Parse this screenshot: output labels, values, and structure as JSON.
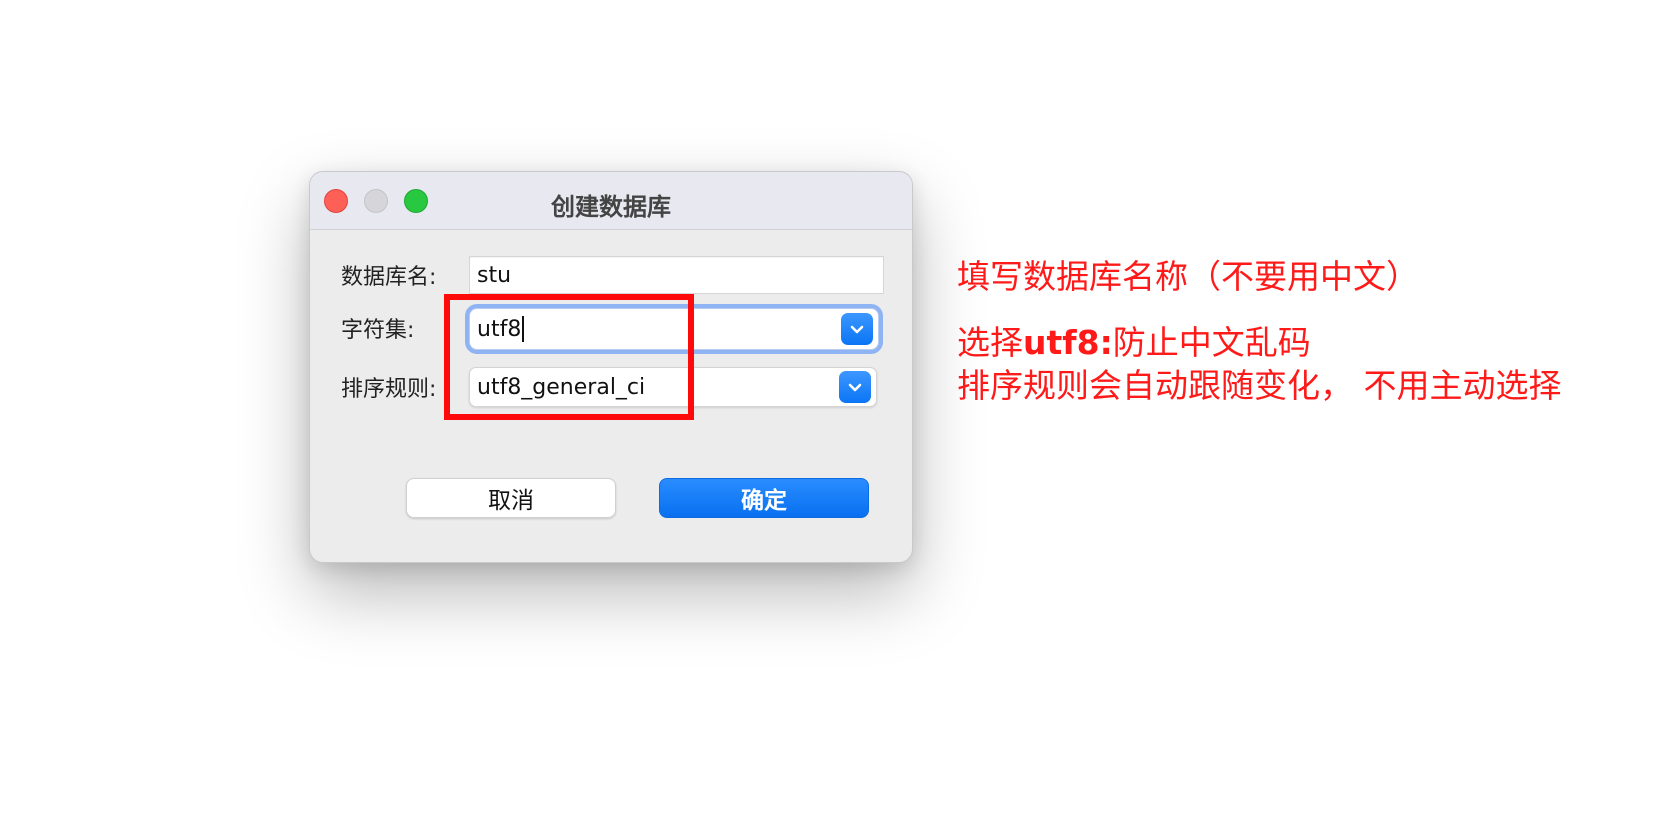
{
  "dialog": {
    "title": "创建数据库",
    "name_label": "数据库名:",
    "name_value": "stu",
    "charset_label": "字符集:",
    "charset_value": "utf8",
    "collation_label": "排序规则:",
    "collation_value": "utf8_general_ci",
    "cancel_label": "取消",
    "ok_label": "确定"
  },
  "annotations": {
    "line1": "填写数据库名称（不要用中文）",
    "line2_prefix": "选择",
    "line2_bold": "utf8:",
    "line2_suffix": "防止中文乱码",
    "line3": "排序规则会自动跟随变化， 不用主动选择"
  },
  "colors": {
    "accent": "#0a75f5",
    "annotation": "#ff0a0a",
    "close": "#fe5f57",
    "zoom": "#28c840"
  }
}
